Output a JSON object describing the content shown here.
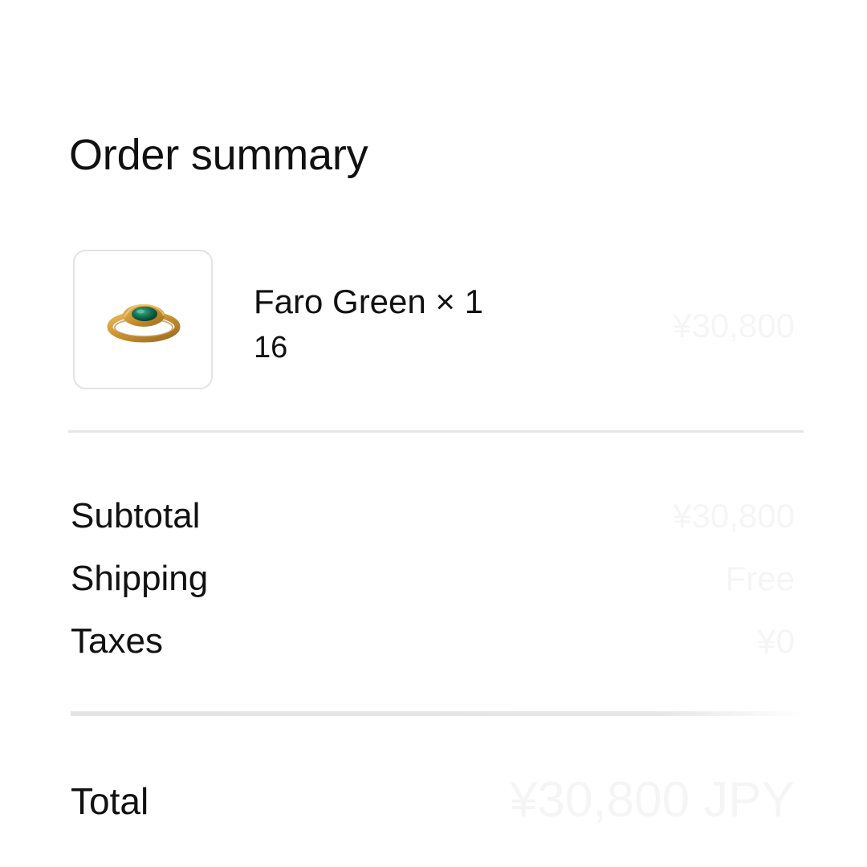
{
  "summary": {
    "title": "Order summary"
  },
  "line_item": {
    "name": "Faro Green × 1",
    "variant": "16",
    "price": "¥30,800",
    "image_icon": "ring-icon"
  },
  "totals": {
    "subtotal_label": "Subtotal",
    "subtotal_value": "¥30,800",
    "shipping_label": "Shipping",
    "shipping_value": "Free",
    "taxes_label": "Taxes",
    "taxes_value": "¥0",
    "total_label": "Total",
    "total_value": "¥30,800 JPY"
  },
  "colors": {
    "text": "#111111",
    "divider": "#e6e6e6",
    "ring_gold": "#c8902f",
    "ring_stone": "#0f6b4f"
  }
}
